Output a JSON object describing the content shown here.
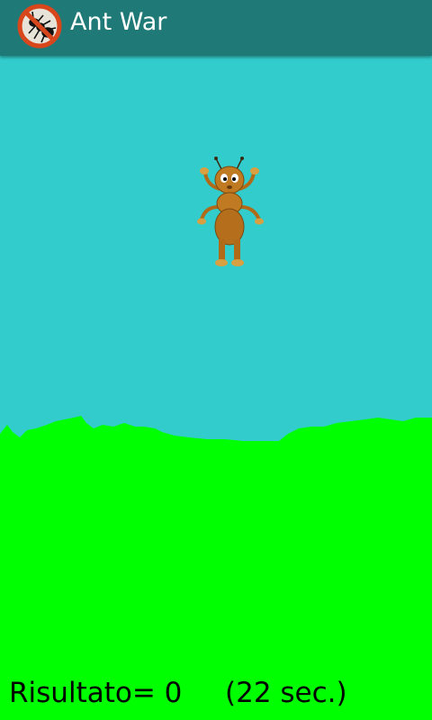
{
  "app": {
    "title": "Ant War",
    "icon": "no-ant-icon"
  },
  "colors": {
    "app_bar": "#1f7a77",
    "sky": "#33cccc",
    "grass": "#00ff00",
    "ant_body": "#c07a22"
  },
  "score": {
    "label": "Risultato= 0",
    "timer": "(22 sec.)"
  }
}
